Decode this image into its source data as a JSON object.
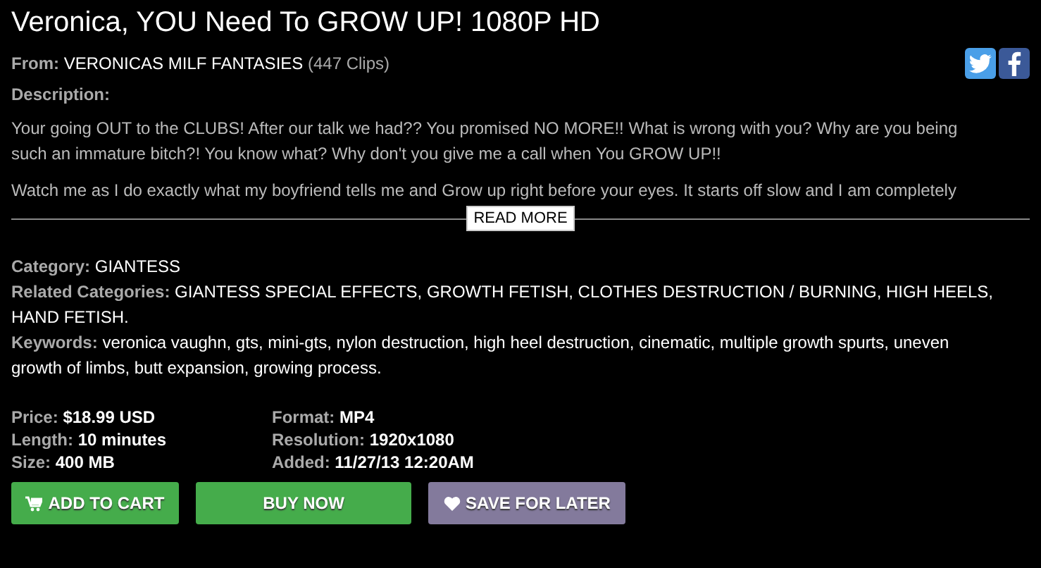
{
  "title": "Veronica, YOU Need To GROW UP! 1080P HD",
  "from": {
    "label": "From:",
    "studio": "VERONICAS MILF FANTASIES",
    "count": "(447 Clips)"
  },
  "share": [
    {
      "kind": "twitter"
    },
    {
      "kind": "facebook"
    }
  ],
  "description": {
    "label": "Description:",
    "paragraphs": [
      "Your going OUT to the CLUBS! After our talk we had?? You promised NO MORE!! What is wrong with you? Why are you being such an immature bitch?! You know what? Why don't you give me a call when You GROW UP!!",
      "Watch me as I do exactly what my boyfriend tells me and Grow up right before your eyes. It starts off slow and I am completely"
    ],
    "read_more": "READ MORE"
  },
  "meta": [
    {
      "label": "Category:",
      "value": "GIANTESS"
    },
    {
      "label": "Related Categories:",
      "value": "GIANTESS SPECIAL EFFECTS, GROWTH FETISH, CLOTHES DESTRUCTION / BURNING, HIGH HEELS, HAND FETISH."
    },
    {
      "label": "Keywords:",
      "value": "veronica vaughn, gts, mini-gts, nylon destruction, high heel destruction, cinematic, multiple growth spurts, uneven growth of limbs, butt expansion, growing process."
    }
  ],
  "details": [
    {
      "label": "Price:",
      "value": "$18.99 USD"
    },
    {
      "label": "Format:",
      "value": "MP4"
    },
    {
      "label": "Length:",
      "value": "10 minutes"
    },
    {
      "label": "Resolution:",
      "value": "1920x1080"
    },
    {
      "label": "Size:",
      "value": "400 MB"
    },
    {
      "label": "Added:",
      "value": "11/27/13 12:20AM"
    }
  ],
  "buttons": [
    {
      "kind": "cart",
      "label": "ADD TO CART"
    },
    {
      "kind": "buy",
      "label": "BUY NOW"
    },
    {
      "kind": "save",
      "label": "SAVE FOR LATER"
    }
  ]
}
